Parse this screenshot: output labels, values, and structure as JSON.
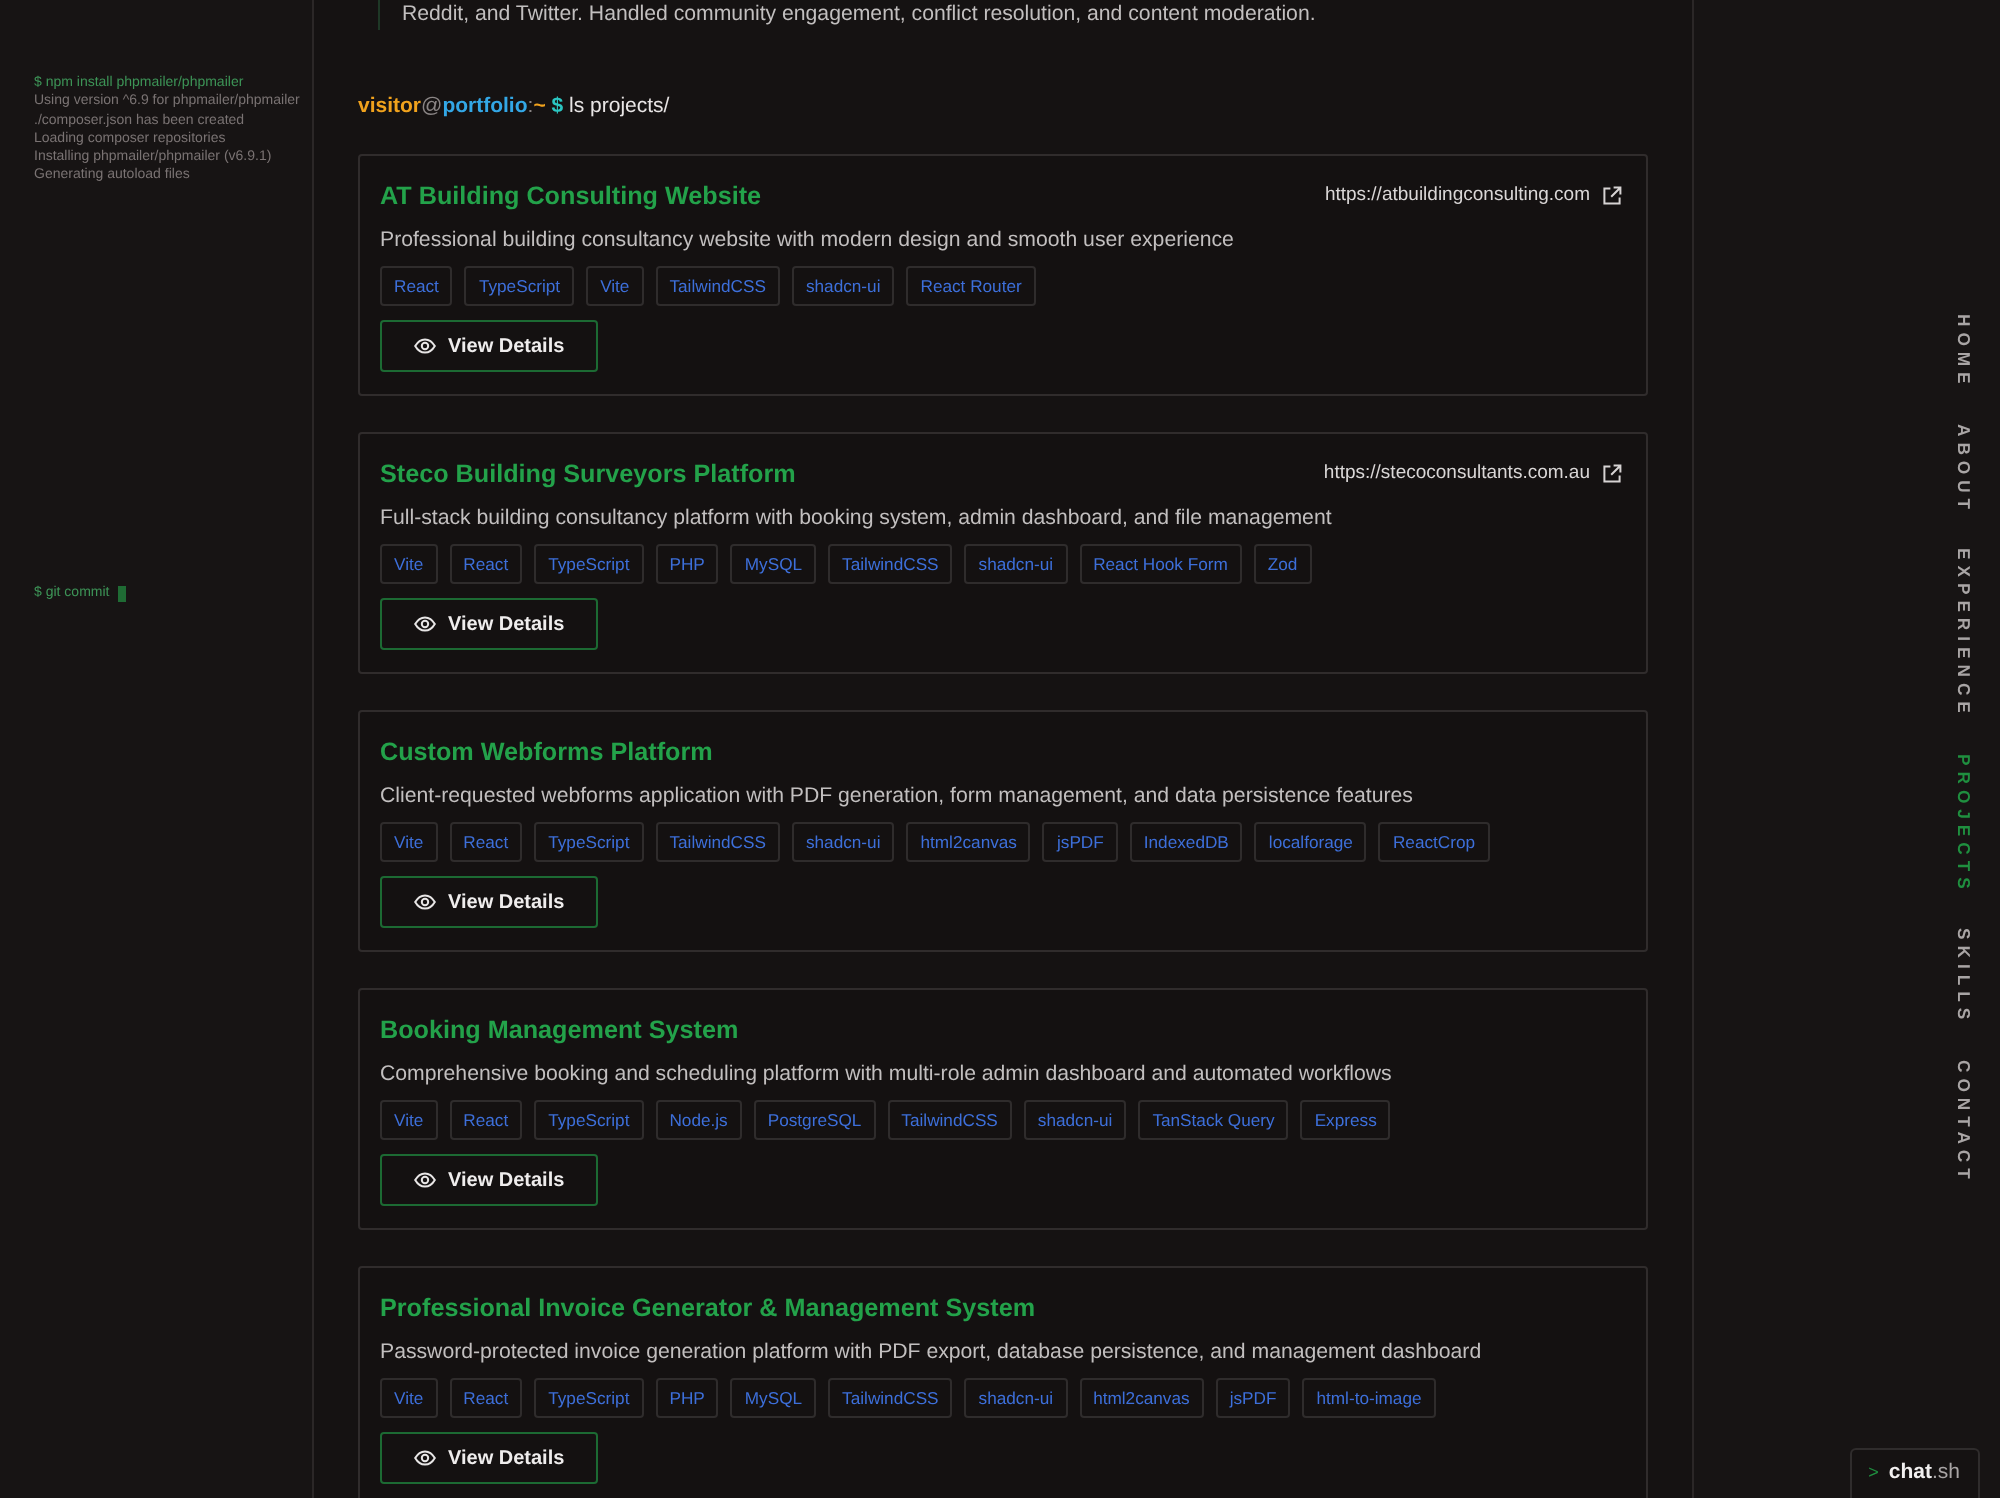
{
  "background_terminal": {
    "lines": [
      {
        "kind": "command",
        "text": "$ npm install phpmailer/phpmailer"
      },
      {
        "kind": "output",
        "text": "Using version ^6.9 for phpmailer/phpmailer"
      },
      {
        "kind": "output",
        "text": "./composer.json has been created"
      },
      {
        "kind": "output",
        "text": "Loading composer repositories"
      },
      {
        "kind": "output",
        "text": "Installing phpmailer/phpmailer (v6.9.1)"
      },
      {
        "kind": "output",
        "text": "Generating autoload files"
      }
    ],
    "input_line": {
      "text": "$ git commit"
    }
  },
  "experience_tail": {
    "text": "Reddit, and Twitter. Handled community engagement, conflict resolution, and content moderation."
  },
  "prompt": {
    "user": "visitor",
    "at": "@",
    "host": "portfolio",
    "separator": ":",
    "path": "~",
    "symbol": "$",
    "command": "ls projects/"
  },
  "projects": [
    {
      "title": "AT Building Consulting Website",
      "url": "https://atbuildingconsulting.com",
      "description": "Professional building consultancy website with modern design and smooth user experience",
      "tags": [
        "React",
        "TypeScript",
        "Vite",
        "TailwindCSS",
        "shadcn-ui",
        "React Router"
      ],
      "button": "View Details"
    },
    {
      "title": "Steco Building Surveyors Platform",
      "url": "https://stecoconsultants.com.au",
      "description": "Full-stack building consultancy platform with booking system, admin dashboard, and file management",
      "tags": [
        "Vite",
        "React",
        "TypeScript",
        "PHP",
        "MySQL",
        "TailwindCSS",
        "shadcn-ui",
        "React Hook Form",
        "Zod"
      ],
      "button": "View Details"
    },
    {
      "title": "Custom Webforms Platform",
      "description": "Client-requested webforms application with PDF generation, form management, and data persistence features",
      "tags": [
        "Vite",
        "React",
        "TypeScript",
        "TailwindCSS",
        "shadcn-ui",
        "html2canvas",
        "jsPDF",
        "IndexedDB",
        "localforage",
        "ReactCrop"
      ],
      "button": "View Details"
    },
    {
      "title": "Booking Management System",
      "description": "Comprehensive booking and scheduling platform with multi-role admin dashboard and automated workflows",
      "tags": [
        "Vite",
        "React",
        "TypeScript",
        "Node.js",
        "PostgreSQL",
        "TailwindCSS",
        "shadcn-ui",
        "TanStack Query",
        "Express"
      ],
      "button": "View Details"
    },
    {
      "title": "Professional Invoice Generator & Management System",
      "description": "Password-protected invoice generation platform with PDF export, database persistence, and management dashboard",
      "tags": [
        "Vite",
        "React",
        "TypeScript",
        "PHP",
        "MySQL",
        "TailwindCSS",
        "shadcn-ui",
        "html2canvas",
        "jsPDF",
        "html-to-image"
      ],
      "button": "View Details"
    }
  ],
  "side_nav": [
    {
      "label": "HOME",
      "selected": false
    },
    {
      "label": "ABOUT",
      "selected": false
    },
    {
      "label": "EXPERIENCE",
      "selected": false
    },
    {
      "label": "PROJECTS",
      "selected": true
    },
    {
      "label": "SKILLS",
      "selected": false
    },
    {
      "label": "CONTACT",
      "selected": false
    }
  ],
  "chat_button": {
    "prompt": ">",
    "name": "chat",
    "extension": ".sh"
  }
}
